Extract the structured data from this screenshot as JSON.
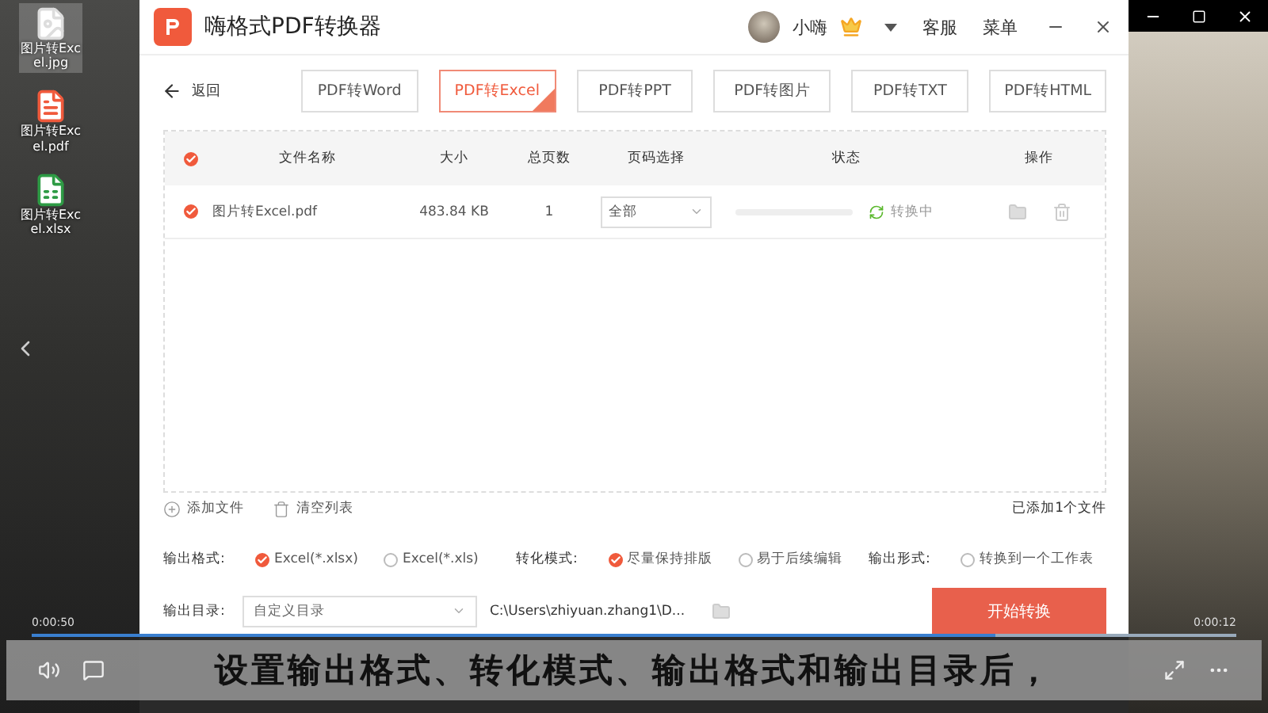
{
  "desktop_icons": [
    {
      "label": "图片转Excel.jpg",
      "kind": "image",
      "selected": true
    },
    {
      "label": "图片转Excel.pdf",
      "kind": "pdf",
      "selected": false
    },
    {
      "label": "图片转Excel.xlsx",
      "kind": "sheet",
      "selected": false
    }
  ],
  "app": {
    "title": "嗨格式PDF转换器",
    "user": "小嗨",
    "links": [
      "客服",
      "菜单"
    ]
  },
  "back": "返回",
  "tabs": [
    {
      "label": "PDF转Word",
      "selected": false
    },
    {
      "label": "PDF转Excel",
      "selected": true
    },
    {
      "label": "PDF转PPT",
      "selected": false
    },
    {
      "label": "PDF转图片",
      "selected": false
    },
    {
      "label": "PDF转TXT",
      "selected": false
    },
    {
      "label": "PDF转HTML",
      "selected": false
    }
  ],
  "table": {
    "all_checked": true,
    "columns": [
      "文件名称",
      "大小",
      "总页数",
      "页码选择",
      "状态",
      "操作"
    ],
    "rows": [
      {
        "checked": true,
        "name": "图片转Excel.pdf",
        "size": "483.84 KB",
        "pages": "1",
        "page_range": "全部",
        "level": 0,
        "status": "转换中"
      }
    ]
  },
  "footer": {
    "add": "添加文件",
    "clear": "清空列表",
    "count": "已添加1个文件"
  },
  "options": [
    {
      "label": "输出格式:",
      "choices": [
        {
          "label": "Excel(*.xlsx)",
          "selected": true
        },
        {
          "label": "Excel(*.xls)",
          "selected": false
        }
      ]
    },
    {
      "label": "转化模式:",
      "choices": [
        {
          "label": "尽量保持排版",
          "selected": true
        },
        {
          "label": "易于后续编辑",
          "selected": false
        }
      ]
    },
    {
      "label": "输出形式:",
      "choices": [
        {
          "label": "转换到一个工作表",
          "selected": false
        }
      ]
    }
  ],
  "output": {
    "label": "输出目录:",
    "select": "自定义目录",
    "path": "C:\\Users\\zhiyuan.zhang1\\D...",
    "button": "开始转换"
  },
  "player": {
    "elapsed": "0:00:50",
    "remaining": "0:00:12",
    "level": 0.8,
    "subtitle": "设置输出格式、转化模式、输出格式和输出目录后，"
  }
}
